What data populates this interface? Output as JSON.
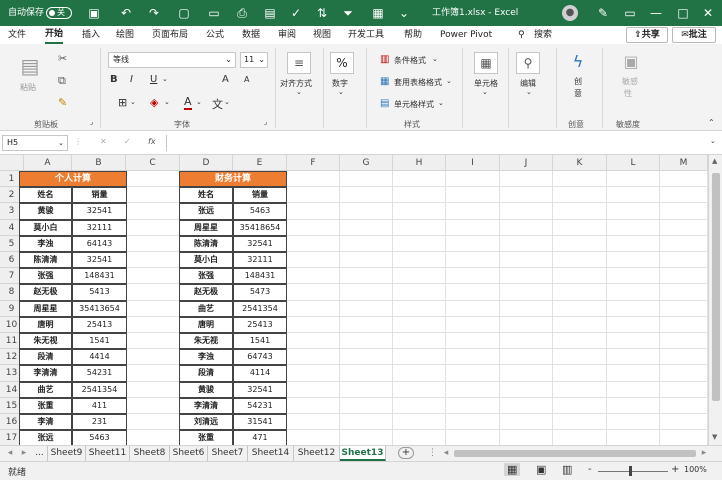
{
  "titlebar": {
    "autosave_label": "自动保存",
    "autosave_state": "关",
    "filename": "工作簿1.xlsx - Excel",
    "bg_color": "#217346"
  },
  "menu": {
    "items": [
      "文件",
      "开始",
      "插入",
      "绘图",
      "页面布局",
      "公式",
      "数据",
      "审阅",
      "视图",
      "开发工具",
      "帮助",
      "Power Pivot"
    ],
    "active": "开始",
    "search_label": "搜索",
    "share_label": "共享",
    "comment_label": "批注"
  },
  "ribbon": {
    "clipboard": {
      "paste": "粘贴",
      "group_label": "剪贴板"
    },
    "font": {
      "name": "等线",
      "size": "11",
      "bold": "B",
      "italic": "I",
      "underline": "U",
      "grow": "A",
      "shrink": "A",
      "group_label": "字体"
    },
    "alignment": {
      "label": "对齐方式"
    },
    "number": {
      "symbol": "%",
      "label": "数字"
    },
    "styles": {
      "conditional": "条件格式",
      "table": "套用表格格式",
      "cell": "单元格样式",
      "group_label": "样式"
    },
    "cells": {
      "label": "单元格"
    },
    "editing": {
      "label": "编辑"
    },
    "create": {
      "label_line1": "创",
      "label_line2": "意",
      "group_label": "创意"
    },
    "sensitivity": {
      "label_line1": "敏感",
      "label_line2": "性",
      "group_label": "敏感度"
    }
  },
  "formula_bar": {
    "name_box": "H5",
    "cancel": "✕",
    "enter": "✓",
    "fx": "fx",
    "content": ""
  },
  "columns": [
    "A",
    "B",
    "C",
    "D",
    "E",
    "F",
    "G",
    "H",
    "I",
    "J",
    "K",
    "L",
    "M"
  ],
  "rows": [
    "1",
    "2",
    "3",
    "4",
    "5",
    "6",
    "7",
    "8",
    "9",
    "10",
    "11",
    "12",
    "13",
    "14",
    "15",
    "16",
    "17"
  ],
  "table1": {
    "title": "个人计算",
    "headers": [
      "姓名",
      "销量"
    ],
    "rows": [
      [
        "黄骏",
        "32541"
      ],
      [
        "莫小白",
        "32111"
      ],
      [
        "李浊",
        "64143"
      ],
      [
        "陈清清",
        "32541"
      ],
      [
        "张强",
        "148431"
      ],
      [
        "赵无极",
        "5413"
      ],
      [
        "周星星",
        "35413654"
      ],
      [
        "唐明",
        "25413"
      ],
      [
        "朱无视",
        "1541"
      ],
      [
        "段清",
        "4414"
      ],
      [
        "李清清",
        "54231"
      ],
      [
        "曲艺",
        "2541354"
      ],
      [
        "张重",
        "411"
      ],
      [
        "李清",
        "231"
      ],
      [
        "张远",
        "5463"
      ]
    ]
  },
  "table2": {
    "title": "财务计算",
    "headers": [
      "姓名",
      "销量"
    ],
    "rows": [
      [
        "张远",
        "5463"
      ],
      [
        "周星星",
        "35418654"
      ],
      [
        "陈清清",
        "32541"
      ],
      [
        "莫小白",
        "32111"
      ],
      [
        "张强",
        "148431"
      ],
      [
        "赵无极",
        "5473"
      ],
      [
        "曲艺",
        "2541354"
      ],
      [
        "唐明",
        "25413"
      ],
      [
        "朱无视",
        "1541"
      ],
      [
        "李浊",
        "64743"
      ],
      [
        "段清",
        "4114"
      ],
      [
        "黄骏",
        "32541"
      ],
      [
        "李清清",
        "54231"
      ],
      [
        "刘清远",
        "31541"
      ],
      [
        "张重",
        "471"
      ]
    ]
  },
  "sheet_tabs": {
    "ellipsis": "...",
    "items": [
      "Sheet9",
      "Sheet11",
      "Sheet8",
      "Sheet6",
      "Sheet7",
      "Sheet14",
      "Sheet12",
      "Sheet13"
    ],
    "active": "Sheet13",
    "add": "+"
  },
  "statusbar": {
    "status": "就绪",
    "zoom": "100%",
    "minus": "-",
    "plus": "+"
  },
  "colors": {
    "accent": "#217346",
    "table_title": "#ed7d31"
  }
}
